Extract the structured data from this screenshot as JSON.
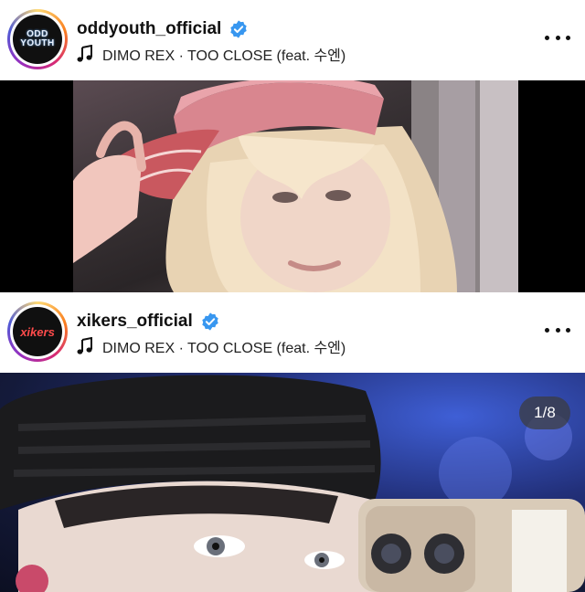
{
  "posts": [
    {
      "username": "oddyouth_official",
      "avatar_text": "ODD YOUTH",
      "verified": true,
      "music": "DIMO REX · TOO CLOSE (feat. 수엔)",
      "icons": {
        "verified": "verified-badge-icon",
        "music": "music-note-icon",
        "more": "more-options-icon"
      }
    },
    {
      "username": "xikers_official",
      "avatar_text": "xikers",
      "verified": true,
      "music": "DIMO REX · TOO CLOSE (feat. 수엔)",
      "carousel_counter": "1/8",
      "icons": {
        "verified": "verified-badge-icon",
        "music": "music-note-icon",
        "more": "more-options-icon"
      }
    }
  ],
  "colors": {
    "verified_blue": "#3897f0",
    "media_background": "#000000",
    "counter_background": "#3c3c3c"
  }
}
